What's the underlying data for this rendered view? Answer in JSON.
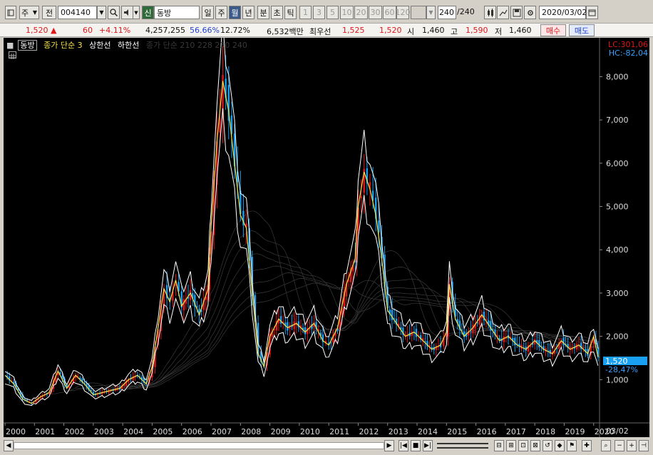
{
  "toolbar": {
    "period_select": "주",
    "prev_label": "전",
    "stock_code": "004140",
    "badge_label": "신",
    "stock_name": "동방",
    "periods": [
      "일",
      "주",
      "월",
      "년"
    ],
    "active_period": "월",
    "intervals": [
      "분",
      "초",
      "틱"
    ],
    "minutes": [
      "1",
      "3",
      "5",
      "10",
      "20",
      "30",
      "60",
      "120"
    ],
    "count_value": "240",
    "count_total": "/240",
    "date_value": "2020/03/02"
  },
  "quote": {
    "price": "1,520",
    "change_symbol": "▲",
    "change": "60",
    "change_pct": "+4.11%",
    "volume": "4,257,255",
    "ratio1": "56.66%",
    "ratio2": "12.72%",
    "amount": "6,532백만",
    "best_label": "최우선",
    "best_ask": "1,525",
    "best_bid": "1,520",
    "open_label": "시",
    "open": "1,460",
    "high_label": "고",
    "high": "1,590",
    "low_label": "저",
    "low": "1,460",
    "buy_label": "매수",
    "sell_label": "매도"
  },
  "legend": {
    "stock": "동방",
    "ma_label": "종가 단순 3",
    "upper_band": "상한선",
    "lower_band": "하한선",
    "ma_long": "종가 단순 210 228 230 240"
  },
  "right_labels": {
    "lc": "LC:301,06",
    "hc": "HC:-82,04",
    "current_price": "1,520",
    "current_pct": "-28,47%",
    "last_date": "03/02"
  },
  "chart_data": {
    "type": "candlestick",
    "x_ticks": [
      "2000",
      "2001",
      "2002",
      "2003",
      "2004",
      "2005",
      "2006",
      "2007",
      "2008",
      "2009",
      "2010",
      "2011",
      "2012",
      "2013",
      "2014",
      "2015",
      "2016",
      "2017",
      "2018",
      "2019",
      "2020"
    ],
    "y_ticks": [
      "1,000",
      "2,000",
      "3,000",
      "4,000",
      "5,000",
      "6,000",
      "7,000",
      "8,000"
    ],
    "y_values": [
      1000,
      2000,
      3000,
      4000,
      5000,
      6000,
      7000,
      8000
    ],
    "ylim": [
      0,
      8700
    ],
    "series": [
      {
        "name": "동방",
        "points": [
          [
            2000.0,
            1100
          ],
          [
            2000.3,
            900
          ],
          [
            2000.6,
            550
          ],
          [
            2000.9,
            450
          ],
          [
            2001.2,
            600
          ],
          [
            2001.5,
            700
          ],
          [
            2001.8,
            1200
          ],
          [
            2002.1,
            800
          ],
          [
            2002.4,
            1100
          ],
          [
            2002.7,
            900
          ],
          [
            2003.0,
            650
          ],
          [
            2003.3,
            700
          ],
          [
            2003.6,
            750
          ],
          [
            2003.9,
            800
          ],
          [
            2004.2,
            1000
          ],
          [
            2004.5,
            1100
          ],
          [
            2004.8,
            900
          ],
          [
            2005.0,
            1300
          ],
          [
            2005.2,
            2200
          ],
          [
            2005.4,
            3100
          ],
          [
            2005.6,
            2800
          ],
          [
            2005.8,
            3300
          ],
          [
            2006.0,
            2700
          ],
          [
            2006.3,
            3000
          ],
          [
            2006.6,
            2500
          ],
          [
            2006.9,
            3100
          ],
          [
            2007.0,
            4500
          ],
          [
            2007.2,
            6500
          ],
          [
            2007.4,
            7900
          ],
          [
            2007.6,
            7200
          ],
          [
            2007.8,
            6000
          ],
          [
            2008.0,
            4800
          ],
          [
            2008.2,
            4500
          ],
          [
            2008.4,
            3000
          ],
          [
            2008.6,
            1600
          ],
          [
            2008.8,
            1300
          ],
          [
            2009.0,
            2000
          ],
          [
            2009.3,
            2400
          ],
          [
            2009.6,
            2200
          ],
          [
            2009.9,
            2300
          ],
          [
            2010.2,
            2100
          ],
          [
            2010.5,
            2300
          ],
          [
            2010.8,
            1900
          ],
          [
            2011.0,
            1800
          ],
          [
            2011.3,
            2200
          ],
          [
            2011.6,
            3200
          ],
          [
            2011.9,
            3800
          ],
          [
            2012.0,
            5000
          ],
          [
            2012.2,
            5800
          ],
          [
            2012.4,
            5400
          ],
          [
            2012.6,
            4800
          ],
          [
            2012.8,
            3800
          ],
          [
            2013.0,
            2600
          ],
          [
            2013.3,
            2300
          ],
          [
            2013.6,
            2000
          ],
          [
            2013.9,
            2100
          ],
          [
            2014.2,
            1900
          ],
          [
            2014.5,
            1700
          ],
          [
            2014.8,
            1800
          ],
          [
            2015.0,
            2100
          ],
          [
            2015.1,
            3200
          ],
          [
            2015.3,
            2400
          ],
          [
            2015.6,
            2000
          ],
          [
            2015.9,
            2200
          ],
          [
            2016.2,
            2500
          ],
          [
            2016.5,
            2200
          ],
          [
            2016.8,
            1900
          ],
          [
            2017.1,
            2000
          ],
          [
            2017.4,
            1800
          ],
          [
            2017.7,
            1700
          ],
          [
            2018.0,
            1900
          ],
          [
            2018.3,
            1700
          ],
          [
            2018.6,
            1600
          ],
          [
            2018.9,
            1900
          ],
          [
            2019.2,
            1700
          ],
          [
            2019.5,
            1800
          ],
          [
            2019.8,
            1600
          ],
          [
            2020.0,
            2000
          ],
          [
            2020.15,
            1520
          ]
        ]
      }
    ]
  }
}
